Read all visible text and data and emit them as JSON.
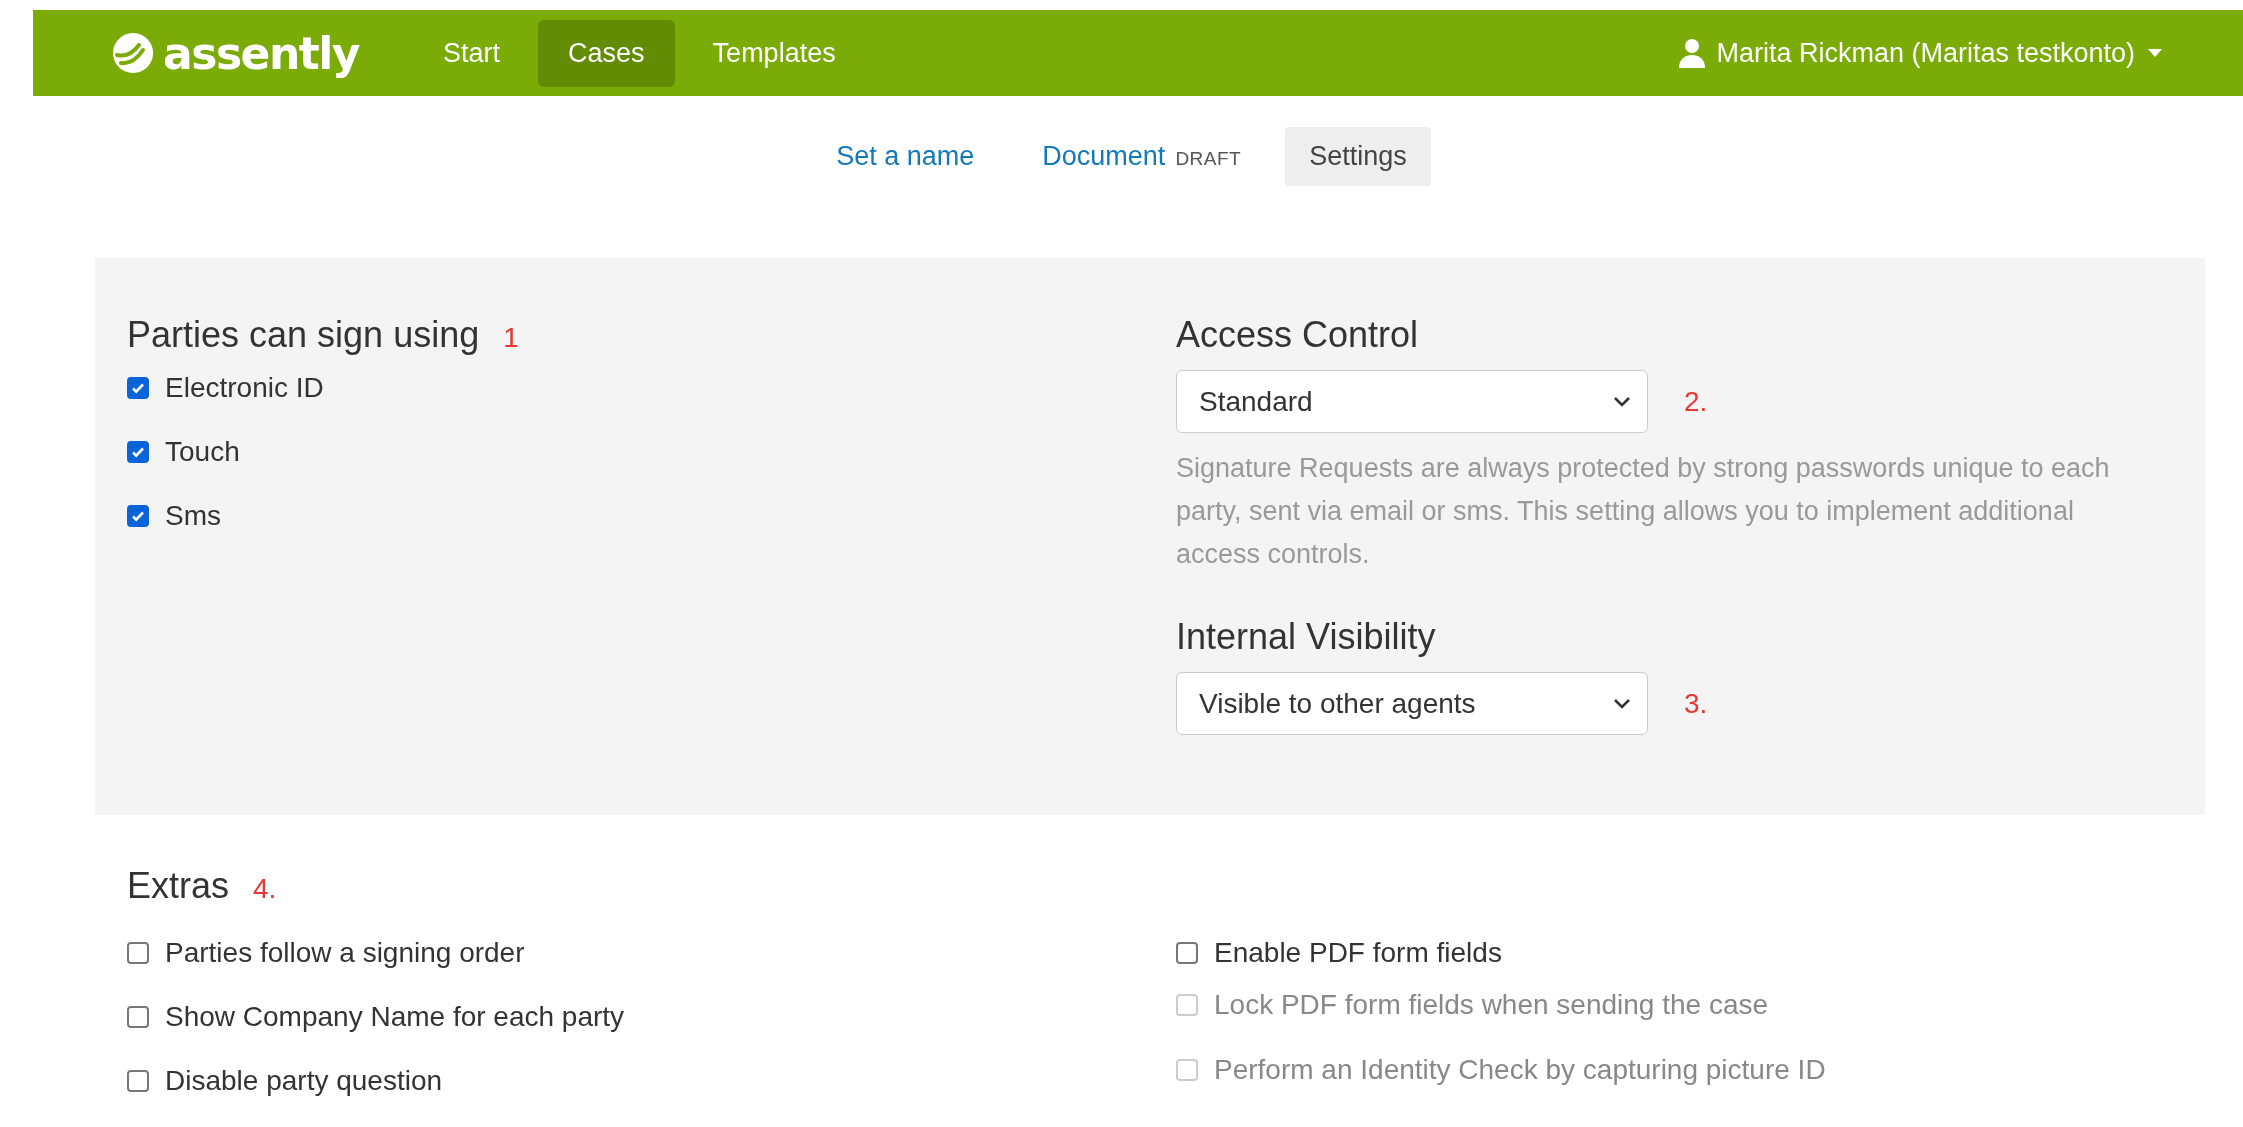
{
  "header": {
    "logo": "assently",
    "nav": [
      {
        "label": "Start",
        "selected": false
      },
      {
        "label": "Cases",
        "selected": true
      },
      {
        "label": "Templates",
        "selected": false
      }
    ],
    "user": "Marita Rickman (Maritas testkonto)"
  },
  "steps": [
    {
      "label": "Set a name",
      "selected": false
    },
    {
      "label": "Document",
      "badge": "DRAFT",
      "selected": false
    },
    {
      "label": "Settings",
      "selected": true
    }
  ],
  "sign_methods": {
    "title": "Parties can sign using",
    "marker": "1",
    "options": [
      {
        "label": "Electronic ID",
        "checked": true
      },
      {
        "label": "Touch",
        "checked": true
      },
      {
        "label": "Sms",
        "checked": true
      }
    ]
  },
  "access_control": {
    "title": "Access Control",
    "value": "Standard",
    "marker": "2.",
    "help": "Signature Requests are always protected by strong passwords unique to each party, sent via email or sms. This setting allows you to implement additional access controls."
  },
  "internal_visibility": {
    "title": "Internal Visibility",
    "value": "Visible to other agents",
    "marker": "3."
  },
  "extras": {
    "title": "Extras",
    "marker": "4.",
    "columns": [
      [
        {
          "label": "Parties follow a signing order",
          "checked": false,
          "disabled": false
        },
        {
          "label": "Show Company Name for each party",
          "checked": false,
          "disabled": false
        },
        {
          "label": "Disable party question",
          "checked": false,
          "disabled": false
        }
      ],
      [
        {
          "label": "Enable PDF form fields",
          "checked": false,
          "disabled": false
        },
        {
          "label": "Lock PDF form fields when sending the case",
          "checked": false,
          "disabled": true
        },
        {
          "label": "Perform an Identity Check by capturing picture ID",
          "checked": false,
          "disabled": true
        }
      ]
    ]
  }
}
